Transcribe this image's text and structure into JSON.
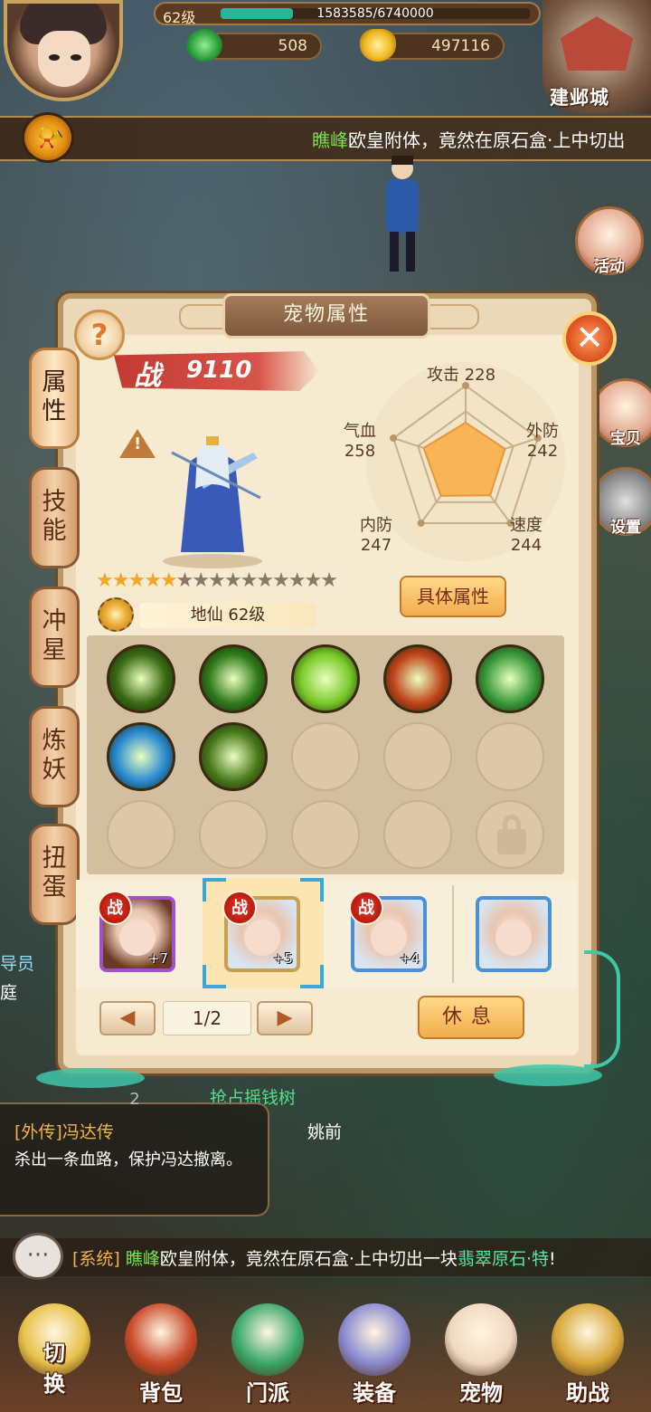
{
  "hud": {
    "level": "62级",
    "exp_text": "1583585/6740000",
    "exp_fraction": 0.235,
    "jade": "508",
    "gold": "497116",
    "city": "建邺城"
  },
  "marquee": {
    "name": "瞧峰",
    "text": "欧皇附体，竟然在原石盒·上中切出"
  },
  "right_buttons": {
    "activity": "活动",
    "treasure": "宝贝",
    "settings": "设置"
  },
  "panel": {
    "title": "宠物属性",
    "tabs": [
      "属\n性",
      "技\n能",
      "冲\n星",
      "炼\n妖",
      "扭\n蛋"
    ],
    "power_label": "战",
    "power_value": "9110",
    "stars_total": 15,
    "stars_lit": 5,
    "grade": "地仙 62级",
    "detail_button": "具体属性",
    "attributes": {
      "attack": {
        "label": "攻击",
        "value": "228"
      },
      "outer_def": {
        "label": "外防",
        "value": "242"
      },
      "speed": {
        "label": "速度",
        "value": "244"
      },
      "inner_def": {
        "label": "内防",
        "value": "247"
      },
      "hp": {
        "label": "气血",
        "value": "258"
      }
    },
    "skills": [
      {
        "icon": "shadow-face-skill-icon",
        "color": "#3a6a12"
      },
      {
        "icon": "slash-skill-icon",
        "color": "#2f7a1a"
      },
      {
        "icon": "burst-skill-icon",
        "color": "#7acb2a"
      },
      {
        "icon": "fire-skill-icon",
        "color": "#c0441a"
      },
      {
        "icon": "bamboo-skill-icon",
        "color": "#3a9a3a"
      },
      {
        "icon": "vortex-skill-icon",
        "color": "#2a8ad0"
      },
      {
        "icon": "shadow-strike-skill-icon",
        "color": "#4a7a1a"
      }
    ],
    "pets": [
      {
        "tag": "战",
        "plus": "+7",
        "frame": "#a050c8"
      },
      {
        "tag": "战",
        "plus": "+5",
        "frame": "#c8a050",
        "selected": true
      },
      {
        "tag": "战",
        "plus": "+4",
        "frame": "#4a90d8"
      },
      {
        "tag": "",
        "plus": "",
        "frame": "#4a90d8"
      }
    ],
    "page": "1/2",
    "rest_button": "休息"
  },
  "quest": {
    "number": "2",
    "title": "[外传]冯达传",
    "desc": "杀出一条血路，保护冯达撤离。"
  },
  "map_labels": {
    "npc_event": "抢占摇钱树",
    "npc_name": "姚前",
    "left_top": "导员",
    "left_bottom": "庭"
  },
  "chat": {
    "channel": "[系统]",
    "name": "瞧峰",
    "text": "欧皇附体，竟然在原石盒·上中切出一块",
    "item": "翡翠原石·特",
    "end": "!"
  },
  "bottom_nav": [
    "切\n换",
    "背包",
    "门派",
    "装备",
    "宠物",
    "助战"
  ]
}
